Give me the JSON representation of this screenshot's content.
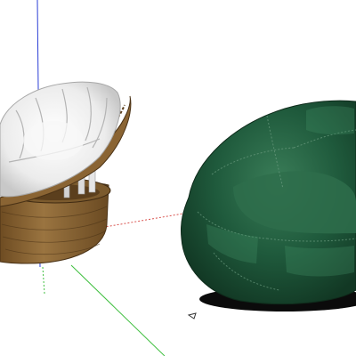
{
  "viewport": {
    "background": "#ffffff",
    "axes": {
      "blue_axis_color": "#2b3fd6",
      "red_axis_color": "#d9534f",
      "green_axis_color": "#3fbf3f"
    }
  },
  "models": [
    {
      "name": "papasan-chair",
      "base_color": "#8a6433",
      "cushion_color": "#f2f2f2"
    },
    {
      "name": "bean-bag-chair",
      "fabric_color": "#1f5a3c",
      "shadow_color": "#0b0b0b"
    }
  ],
  "cursor": {
    "icon": "orbit-cursor-icon"
  }
}
